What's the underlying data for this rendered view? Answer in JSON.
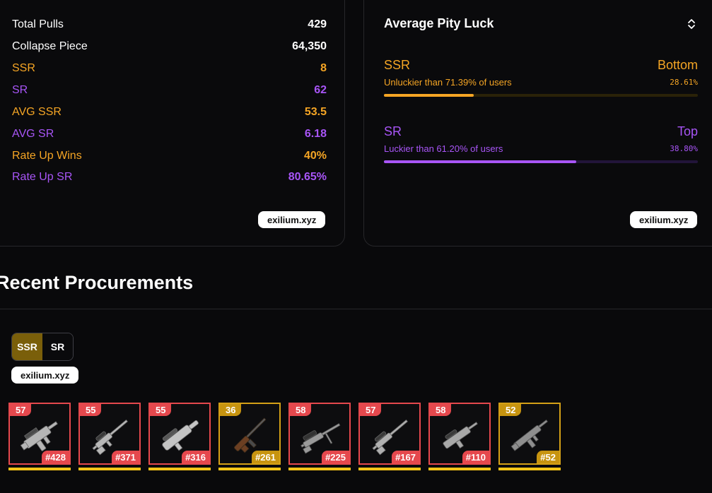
{
  "stats": {
    "rows": [
      {
        "label": "Total Pulls",
        "value": "429",
        "tone": "white"
      },
      {
        "label": "Collapse Piece",
        "value": "64,350",
        "tone": "white"
      },
      {
        "label": "SSR",
        "value": "8",
        "tone": "gold"
      },
      {
        "label": "SR",
        "value": "62",
        "tone": "purple"
      },
      {
        "label": "AVG SSR",
        "value": "53.5",
        "tone": "gold"
      },
      {
        "label": "AVG SR",
        "value": "6.18",
        "tone": "purple"
      },
      {
        "label": "Rate Up Wins",
        "value": "40%",
        "tone": "gold"
      },
      {
        "label": "Rate Up SR",
        "value": "80.65%",
        "tone": "purple"
      }
    ],
    "watermark": "exilium.xyz"
  },
  "pity": {
    "title": "Average Pity Luck",
    "sort_icon": "chevron-up-down-icon",
    "ssr": {
      "label": "SSR",
      "rank": "Bottom",
      "text": "Unluckier than 71.39% of users",
      "percent": "28.61%",
      "fill": 0.2861
    },
    "sr": {
      "label": "SR",
      "rank": "Top",
      "text": "Luckier than 61.20% of users",
      "percent": "38.80%",
      "fill": 0.612
    },
    "watermark": "exilium.xyz"
  },
  "procurements": {
    "title": "Recent Procurements",
    "toggle": {
      "ssr": "SSR",
      "sr": "SR",
      "selected": "SSR"
    },
    "watermark": "exilium.xyz",
    "pulls": [
      {
        "pity": "57",
        "number": "#428",
        "tone": "red",
        "weapon_icon": "smg-icon"
      },
      {
        "pity": "55",
        "number": "#371",
        "tone": "red",
        "weapon_icon": "sniper-rifle-icon"
      },
      {
        "pity": "55",
        "number": "#316",
        "tone": "red",
        "weapon_icon": "heavy-rifle-icon"
      },
      {
        "pity": "36",
        "number": "#261",
        "tone": "gold",
        "weapon_icon": "wooden-rifle-icon"
      },
      {
        "pity": "58",
        "number": "#225",
        "tone": "red",
        "weapon_icon": "scoped-rifle-icon"
      },
      {
        "pity": "57",
        "number": "#167",
        "tone": "red",
        "weapon_icon": "sniper-rifle-icon"
      },
      {
        "pity": "58",
        "number": "#110",
        "tone": "red",
        "weapon_icon": "compact-rifle-icon"
      },
      {
        "pity": "52",
        "number": "#52",
        "tone": "gold",
        "weapon_icon": "assault-rifle-icon"
      }
    ]
  },
  "colors": {
    "gold": "#f5a524",
    "purple": "#a855f7",
    "red": "#e5484d",
    "underline": "#f5c518"
  }
}
